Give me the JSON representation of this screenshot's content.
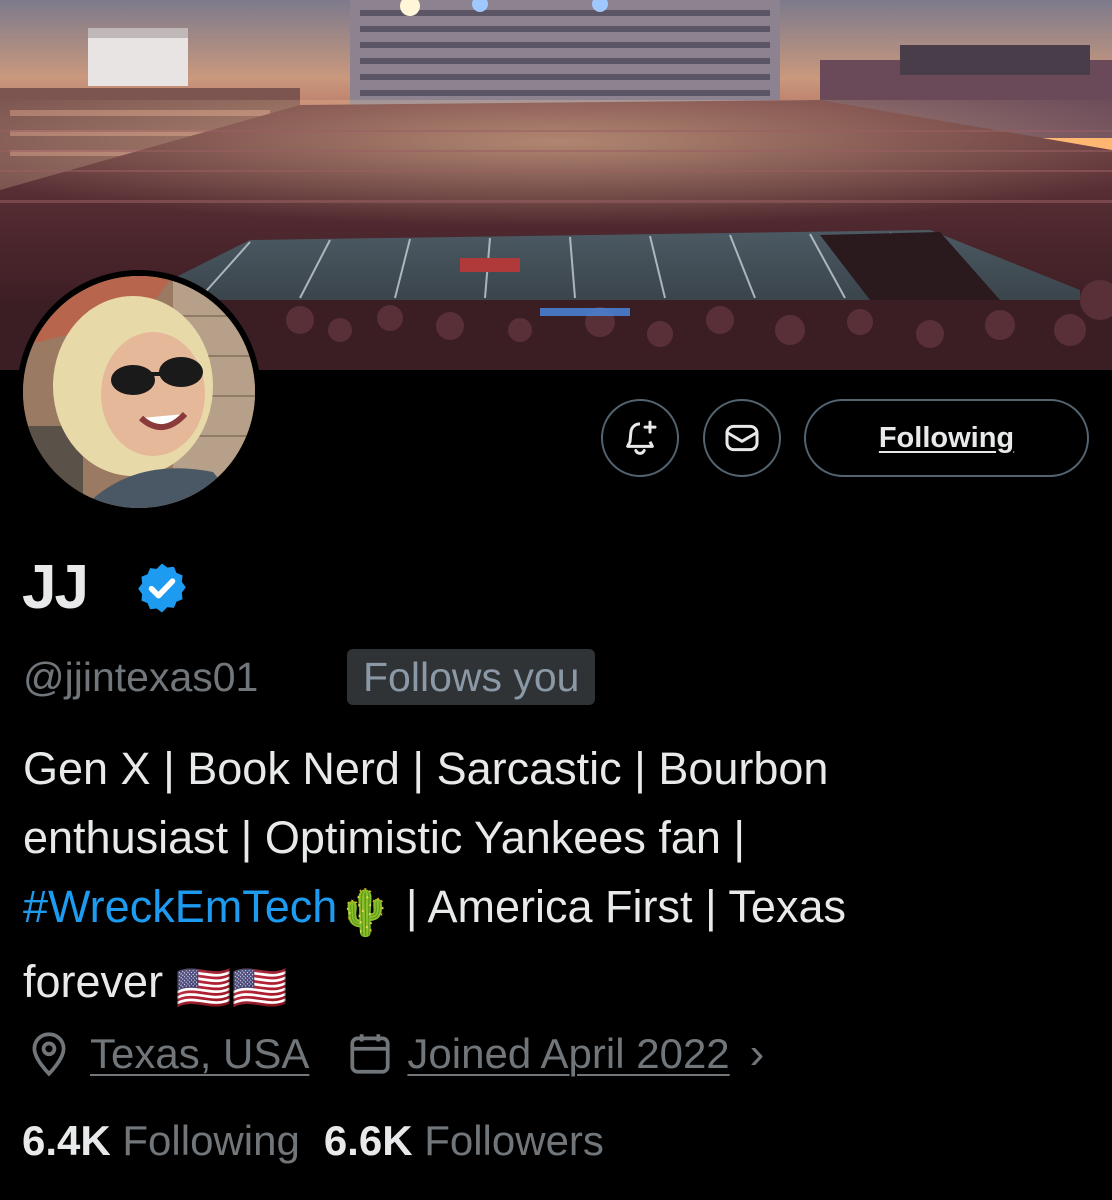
{
  "profile": {
    "display_name": "JJ",
    "handle": "@jjintexas01",
    "follows_you_badge": "Follows you",
    "bio": {
      "line1": "Gen X | Book Nerd | Sarcastic | Bourbon",
      "line2": "enthusiast | Optimistic Yankees fan |",
      "hashtag": "#WreckEmTech",
      "hashtag_emoji": "🌵",
      "line3_rest": "| America First | Texas",
      "line4": "forever",
      "flag_emoji": "🇺🇸🇺🇸"
    },
    "location": "Texas, USA",
    "joined": "Joined April 2022",
    "joined_chevron": "›",
    "following_count": "6.4K",
    "following_label": "Following",
    "followers_count": "6.6K",
    "followers_label": "Followers"
  },
  "actions": {
    "notify_icon": "bell-plus-icon",
    "message_icon": "mail-icon",
    "following_button_label": "Following"
  },
  "icons": {
    "verified": "verified-badge-icon",
    "location": "location-pin-icon",
    "calendar": "calendar-icon"
  },
  "colors": {
    "background": "#000000",
    "accent_blue": "#1d9bf0",
    "text_primary": "#e7e9ea",
    "text_secondary": "#71767b",
    "border": "#536471",
    "badge_bg": "#2f3336"
  }
}
